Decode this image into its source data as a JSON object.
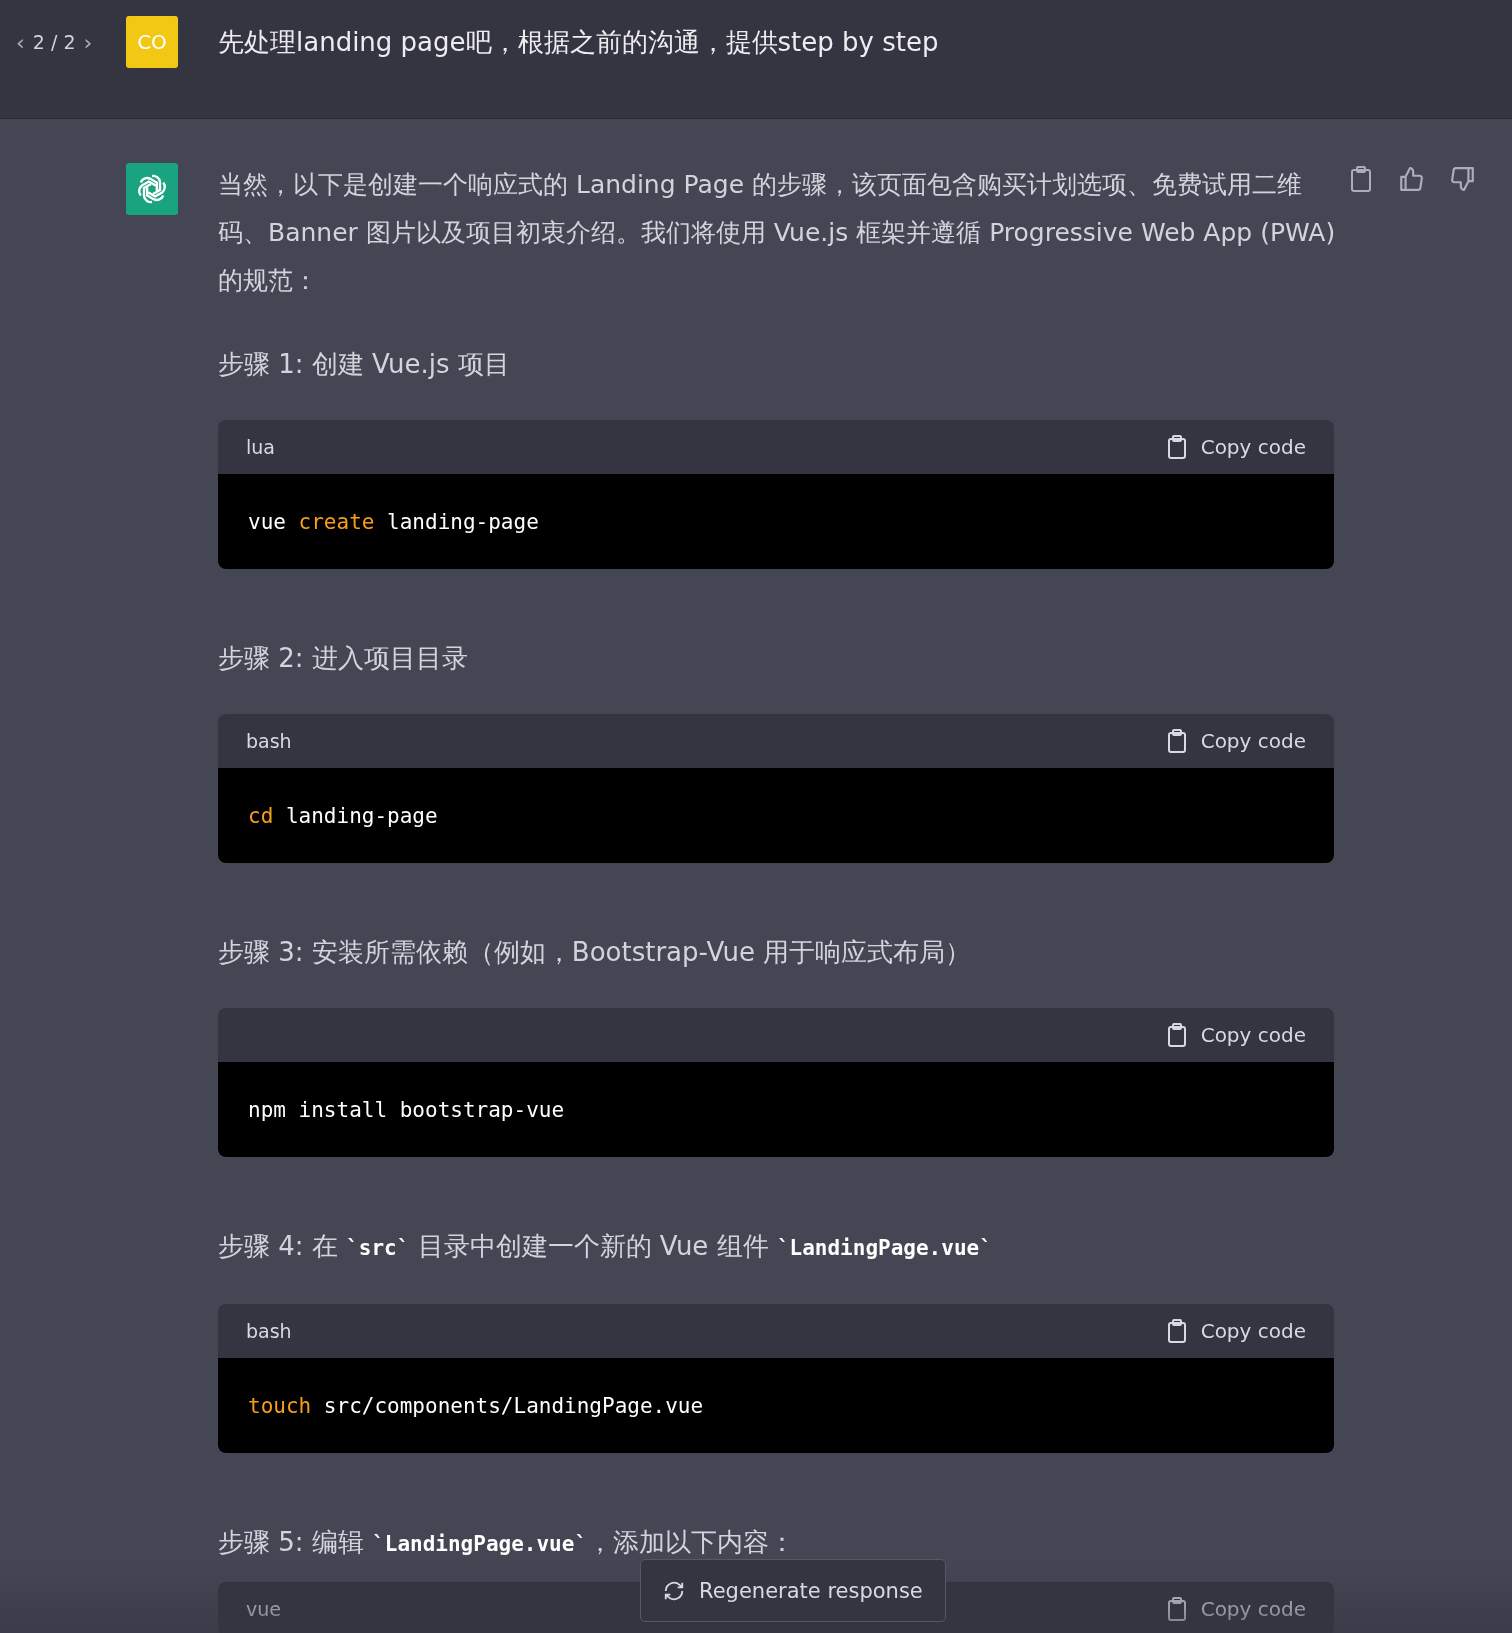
{
  "user_message": {
    "pager": {
      "prev": "‹",
      "label": "2 / 2",
      "next": "›"
    },
    "avatar": "CO",
    "text": "先处理landing page吧，根据之前的沟通，提供step by step"
  },
  "assistant_message": {
    "intro": "当然，以下是创建一个响应式的 Landing Page 的步骤，该页面包含购买计划选项、免费试用二维码、Banner 图片以及项目初衷介绍。我们将使用 Vue.js 框架并遵循 Progressive Web App (PWA) 的规范：",
    "steps": [
      {
        "heading": [
          {
            "kind": "text",
            "text": "步骤 1: 创建 Vue.js 项目"
          }
        ],
        "code": {
          "language": "lua",
          "copy_label": "Copy code",
          "tokens": [
            {
              "kind": "plain",
              "text": "vue "
            },
            {
              "kind": "keyword",
              "text": "create"
            },
            {
              "kind": "plain",
              "text": " landing-page"
            }
          ]
        }
      },
      {
        "heading": [
          {
            "kind": "text",
            "text": "步骤 2: 进入项目目录"
          }
        ],
        "code": {
          "language": "bash",
          "copy_label": "Copy code",
          "tokens": [
            {
              "kind": "keyword",
              "text": "cd"
            },
            {
              "kind": "plain",
              "text": " landing-page"
            }
          ]
        }
      },
      {
        "heading": [
          {
            "kind": "text",
            "text": "步骤 3: 安装所需依赖（例如，Bootstrap-Vue 用于响应式布局）"
          }
        ],
        "code": {
          "copy_label": "Copy code",
          "tokens": [
            {
              "kind": "plain",
              "text": "npm install bootstrap-vue"
            }
          ]
        }
      },
      {
        "heading": [
          {
            "kind": "text",
            "text": "步骤 4: 在 "
          },
          {
            "kind": "code",
            "text": "`src`"
          },
          {
            "kind": "text",
            "text": " 目录中创建一个新的 Vue 组件 "
          },
          {
            "kind": "code",
            "text": "`LandingPage.vue`"
          }
        ],
        "code": {
          "language": "bash",
          "copy_label": "Copy code",
          "tokens": [
            {
              "kind": "keyword",
              "text": "touch"
            },
            {
              "kind": "plain",
              "text": " src/components/LandingPage.vue"
            }
          ]
        }
      },
      {
        "heading": [
          {
            "kind": "text",
            "text": "步骤 5: 编辑 "
          },
          {
            "kind": "code",
            "text": "`LandingPage.vue`"
          },
          {
            "kind": "text",
            "text": "，添加以下内容："
          }
        ],
        "code": {
          "language": "vue",
          "copy_label": "Copy code"
        }
      }
    ]
  },
  "regenerate_button": {
    "label": "Regenerate response"
  }
}
